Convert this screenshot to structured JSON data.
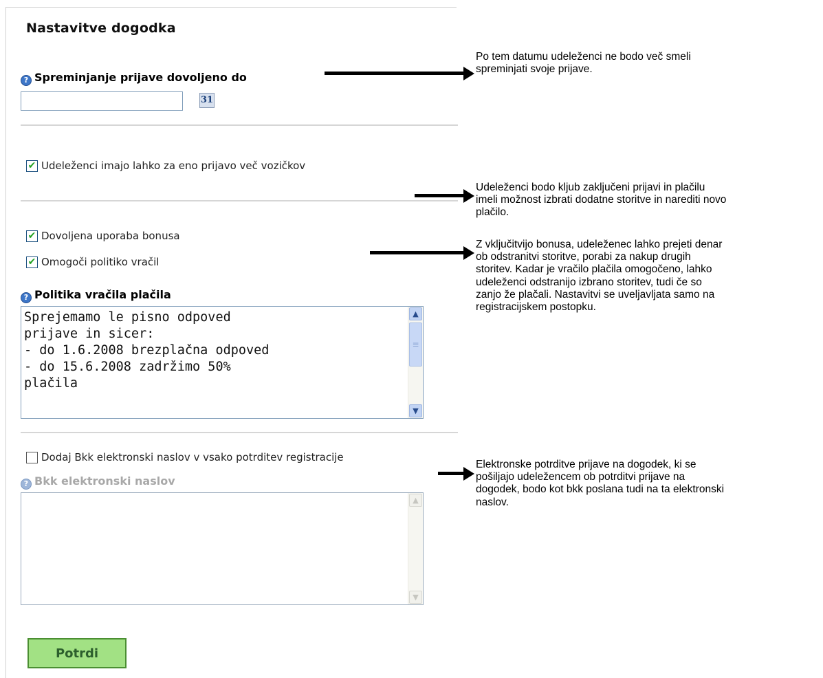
{
  "panel": {
    "title": "Nastavitve dogodka",
    "edit_deadline": {
      "label": "Spreminjanje prijave dovoljeno do",
      "value": "",
      "calendar_icon": "calendar-icon",
      "calendar_text": "31"
    },
    "multiple_carts": {
      "label": "Udeleženci imajo lahko za eno prijavo več vozičkov",
      "checked": true
    },
    "allow_bonus": {
      "label": "Dovoljena uporaba bonusa",
      "checked": true
    },
    "refund_policy_enabled": {
      "label": "Omogoči politiko vračil",
      "checked": true
    },
    "refund_policy": {
      "label": "Politika vračila plačila",
      "text": "Sprejemamo le pisno odpoved\nprijave in sicer:\n- do 1.6.2008 brezplačna odpoved\n- do 15.6.2008 zadržimo 50%\nplačila"
    },
    "bcc_add": {
      "label": "Dodaj Bkk elektronski naslov v vsako potrditev registracije",
      "checked": false
    },
    "bcc_field": {
      "label": "Bkk elektronski naslov",
      "value": ""
    },
    "confirm_label": "Potrdi"
  },
  "annotations": {
    "deadline_note": "Po tem datumu udeleženci ne bodo več smeli\nspreminjati svoje prijave.",
    "carts_note": "Udeleženci bodo kljub zaključeni prijavi in plačilu\nimeli možnost izbrati dodatne storitve in narediti novo\nplačilo.",
    "bonus_note": "Z vključitvijo bonusa, udeleženec lahko prejeti denar\nob odstranitvi storitve, porabi za nakup drugih\nstoritev. Kadar je vračilo plačila omogočeno, lahko\nudeleženci odstranijo izbrano storitev, tudi če so\nzanjo že plačali. Nastavitvi se uveljavljata samo na\nregistracijskem postopku.",
    "bcc_note": "Elektronske potrditve prijave na dogodek, ki se\npošiljajo udeležencem ob potrditvi prijave na\ndogodek, bodo kot bkk poslana tudi na ta elektronski\nnaslov."
  },
  "icons": {
    "help": "help-icon",
    "check": "checkmark-icon",
    "scroll_up": "scroll-up-arrow-icon",
    "scroll_down": "scroll-down-arrow-icon"
  },
  "colors": {
    "confirm_bg": "#a2e184",
    "confirm_border": "#4b8f32",
    "help_icon": "#3d76c8",
    "checkmark": "#21a121",
    "input_border": "#7f9db9"
  }
}
